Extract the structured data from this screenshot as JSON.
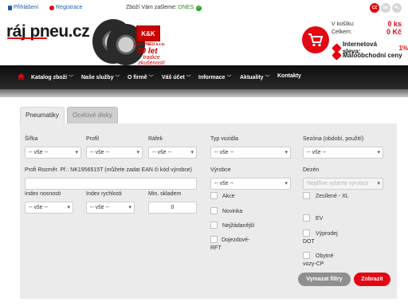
{
  "topbar": {
    "login_label": "Přihlášení",
    "register_label": "Registrace",
    "ship_text": "Zboží Vám zašleme:",
    "ship_day": "DNES",
    "languages": [
      {
        "code": "CZ",
        "color": "#e30613"
      },
      {
        "code": "SK",
        "color": "#d6d6d6"
      },
      {
        "code": "PL",
        "color": "#d6d6d6"
      }
    ]
  },
  "header": {
    "logo_text": "ráj pneu.cz",
    "kk_badge": "K&K",
    "kk_name": "K&K PNEU s.r.o.",
    "years": "30 let",
    "tradition": "tradice zkušeností",
    "cart": {
      "items_label": "V košíku:",
      "items_value": "0 ks",
      "total_label": "Celkem:",
      "total_value": "0 Kč"
    },
    "promo_discount_label": "Internetová sleva:",
    "promo_discount_value": "1%",
    "promo_retail_label": "Maloobchodní ceny"
  },
  "nav": {
    "items": [
      {
        "label": "Katalog zboží",
        "chevron": "﹀"
      },
      {
        "label": "Naše služby",
        "chevron": "﹀"
      },
      {
        "label": "O firmě",
        "chevron": "﹀"
      },
      {
        "label": "Váš účet",
        "chevron": "﹀"
      },
      {
        "label": "Informace",
        "chevron": "﹀"
      },
      {
        "label": "Aktuality",
        "chevron": "﹀"
      },
      {
        "label": "Kontakty",
        "chevron": ""
      }
    ]
  },
  "search": {
    "tabs": [
      "Pneumatiky",
      "Ocelové disky"
    ],
    "width_label": "Šířka",
    "profile_label": "Profil",
    "rim_label": "Ráfek",
    "vehicle_label": "Typ vozidla",
    "season_label": "Sezóna (období, použití)",
    "select_all": "-- vše --",
    "code_label": "Profi Rozměr. Př.: NK1956515T (můžete zadat EAN či kód výrobce)",
    "manufacturer_label": "Výrobce",
    "design_label": "Dezén",
    "design_placeholder": "Nejdříve vyberte výrobce",
    "load_label": "Index nosnosti",
    "speed_label": "Index rychlosti",
    "stock_label": "Min. skladem",
    "stock_value": "0",
    "checks_left": [
      "Akce",
      "Novinka",
      "Nejžádanější",
      "Dojezdové-RFT"
    ],
    "checks_right": [
      "Zesílené - XL",
      "EV",
      "Výprodej DOT",
      "Obytné vozy-CP"
    ],
    "clear_button": "Vymazat filtry",
    "show_button": "Zobrazit"
  }
}
